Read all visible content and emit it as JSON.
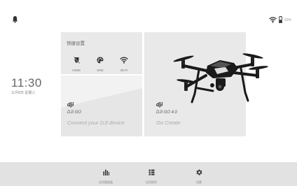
{
  "status": {
    "left_icon": "notification-bell-icon",
    "battery_percent": "50%",
    "wifi_icon": "wifi-icon",
    "battery_icon": "battery-icon"
  },
  "clock": {
    "time": "11:30",
    "date": "11月8日 星期三"
  },
  "quick_settings": {
    "title": "快捷设置",
    "items": [
      {
        "label": "HDMI",
        "icon": "hdmi-icon"
      },
      {
        "label": "SRE",
        "icon": "palette-icon"
      },
      {
        "label": "Wi-Fi",
        "icon": "wifi-icon"
      }
    ]
  },
  "apps": [
    {
      "logo": "dji",
      "name": "DJI GO",
      "subtitle": "Connect your DJI device"
    },
    {
      "logo": "dji",
      "name": "DJI GO 4.0",
      "subtitle": "Go Create"
    }
  ],
  "dock": [
    {
      "label": "应用管理器",
      "icon": "bars-icon"
    },
    {
      "label": "应用程序",
      "icon": "app-list-icon"
    },
    {
      "label": "设置",
      "icon": "gear-icon"
    }
  ],
  "colors": {
    "card": "#e9e9e9",
    "dock": "#e2e2e2",
    "text_dark": "#333333",
    "text_light": "#aaaaaa"
  }
}
